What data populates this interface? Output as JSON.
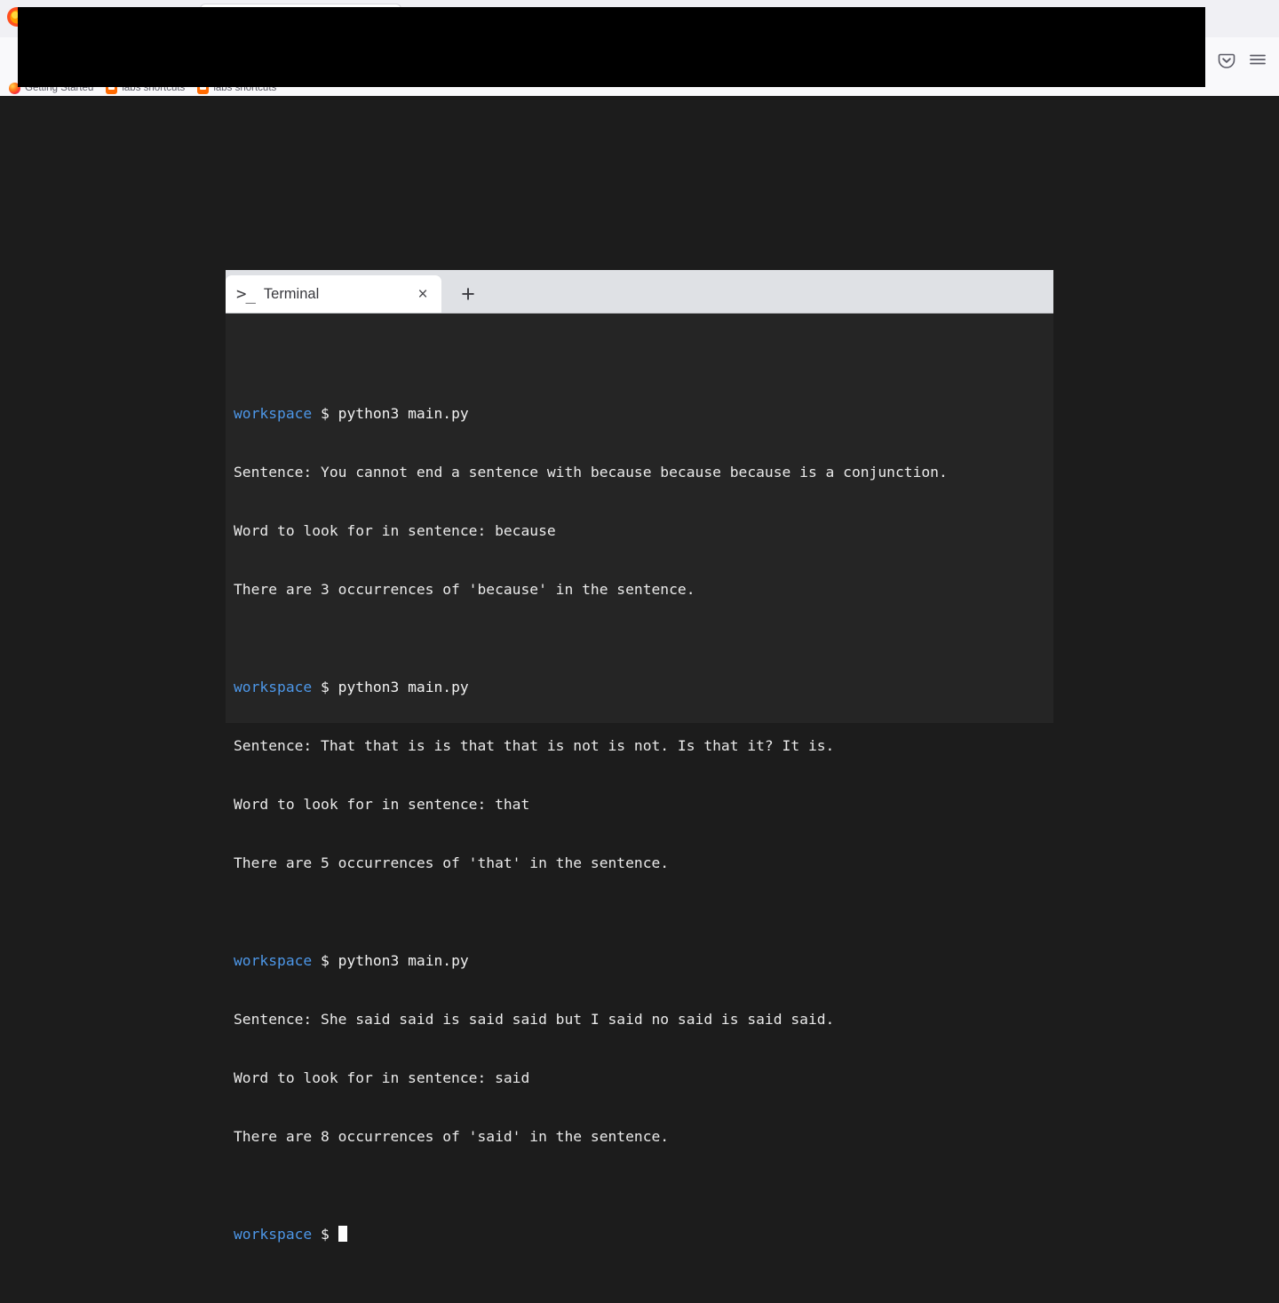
{
  "browser": {
    "bookmarks": [
      {
        "label": "Getting Started",
        "favicon": "firefox-favicon"
      },
      {
        "label": "labs shortcuts",
        "favicon": "labs-favicon"
      },
      {
        "label": "labs shortcuts",
        "favicon": "labs-favicon"
      }
    ],
    "toolbar": {
      "pocket_label": "Pocket",
      "menu_label": "Open application menu"
    }
  },
  "terminal": {
    "tab": {
      "prompt_icon": ">_",
      "title": "Terminal",
      "close_label": "×"
    },
    "new_tab_label": "+",
    "prompt_host": "workspace",
    "prompt_symbol": "$",
    "cursor": "block",
    "colors": {
      "background": "#252525",
      "foreground": "#eaeaea",
      "host": "#4d97e8",
      "tabbar": "#dfe1e5",
      "active_tab": "#ffffff",
      "page_background": "#1c1c1c"
    },
    "sessions": [
      {
        "command": "python3 main.py",
        "output": [
          "Sentence: You cannot end a sentence with because because because is a conjunction.",
          "Word to look for in sentence: because",
          "There are 3 occurrences of 'because' in the sentence."
        ]
      },
      {
        "command": "python3 main.py",
        "output": [
          "Sentence: That that is is that that is not is not. Is that it? It is.",
          "Word to look for in sentence: that",
          "There are 5 occurrences of 'that' in the sentence."
        ]
      },
      {
        "command": "python3 main.py",
        "output": [
          "Sentence: She said said is said said but I said no said is said said.",
          "Word to look for in sentence: said",
          "There are 8 occurrences of 'said' in the sentence."
        ]
      }
    ]
  }
}
